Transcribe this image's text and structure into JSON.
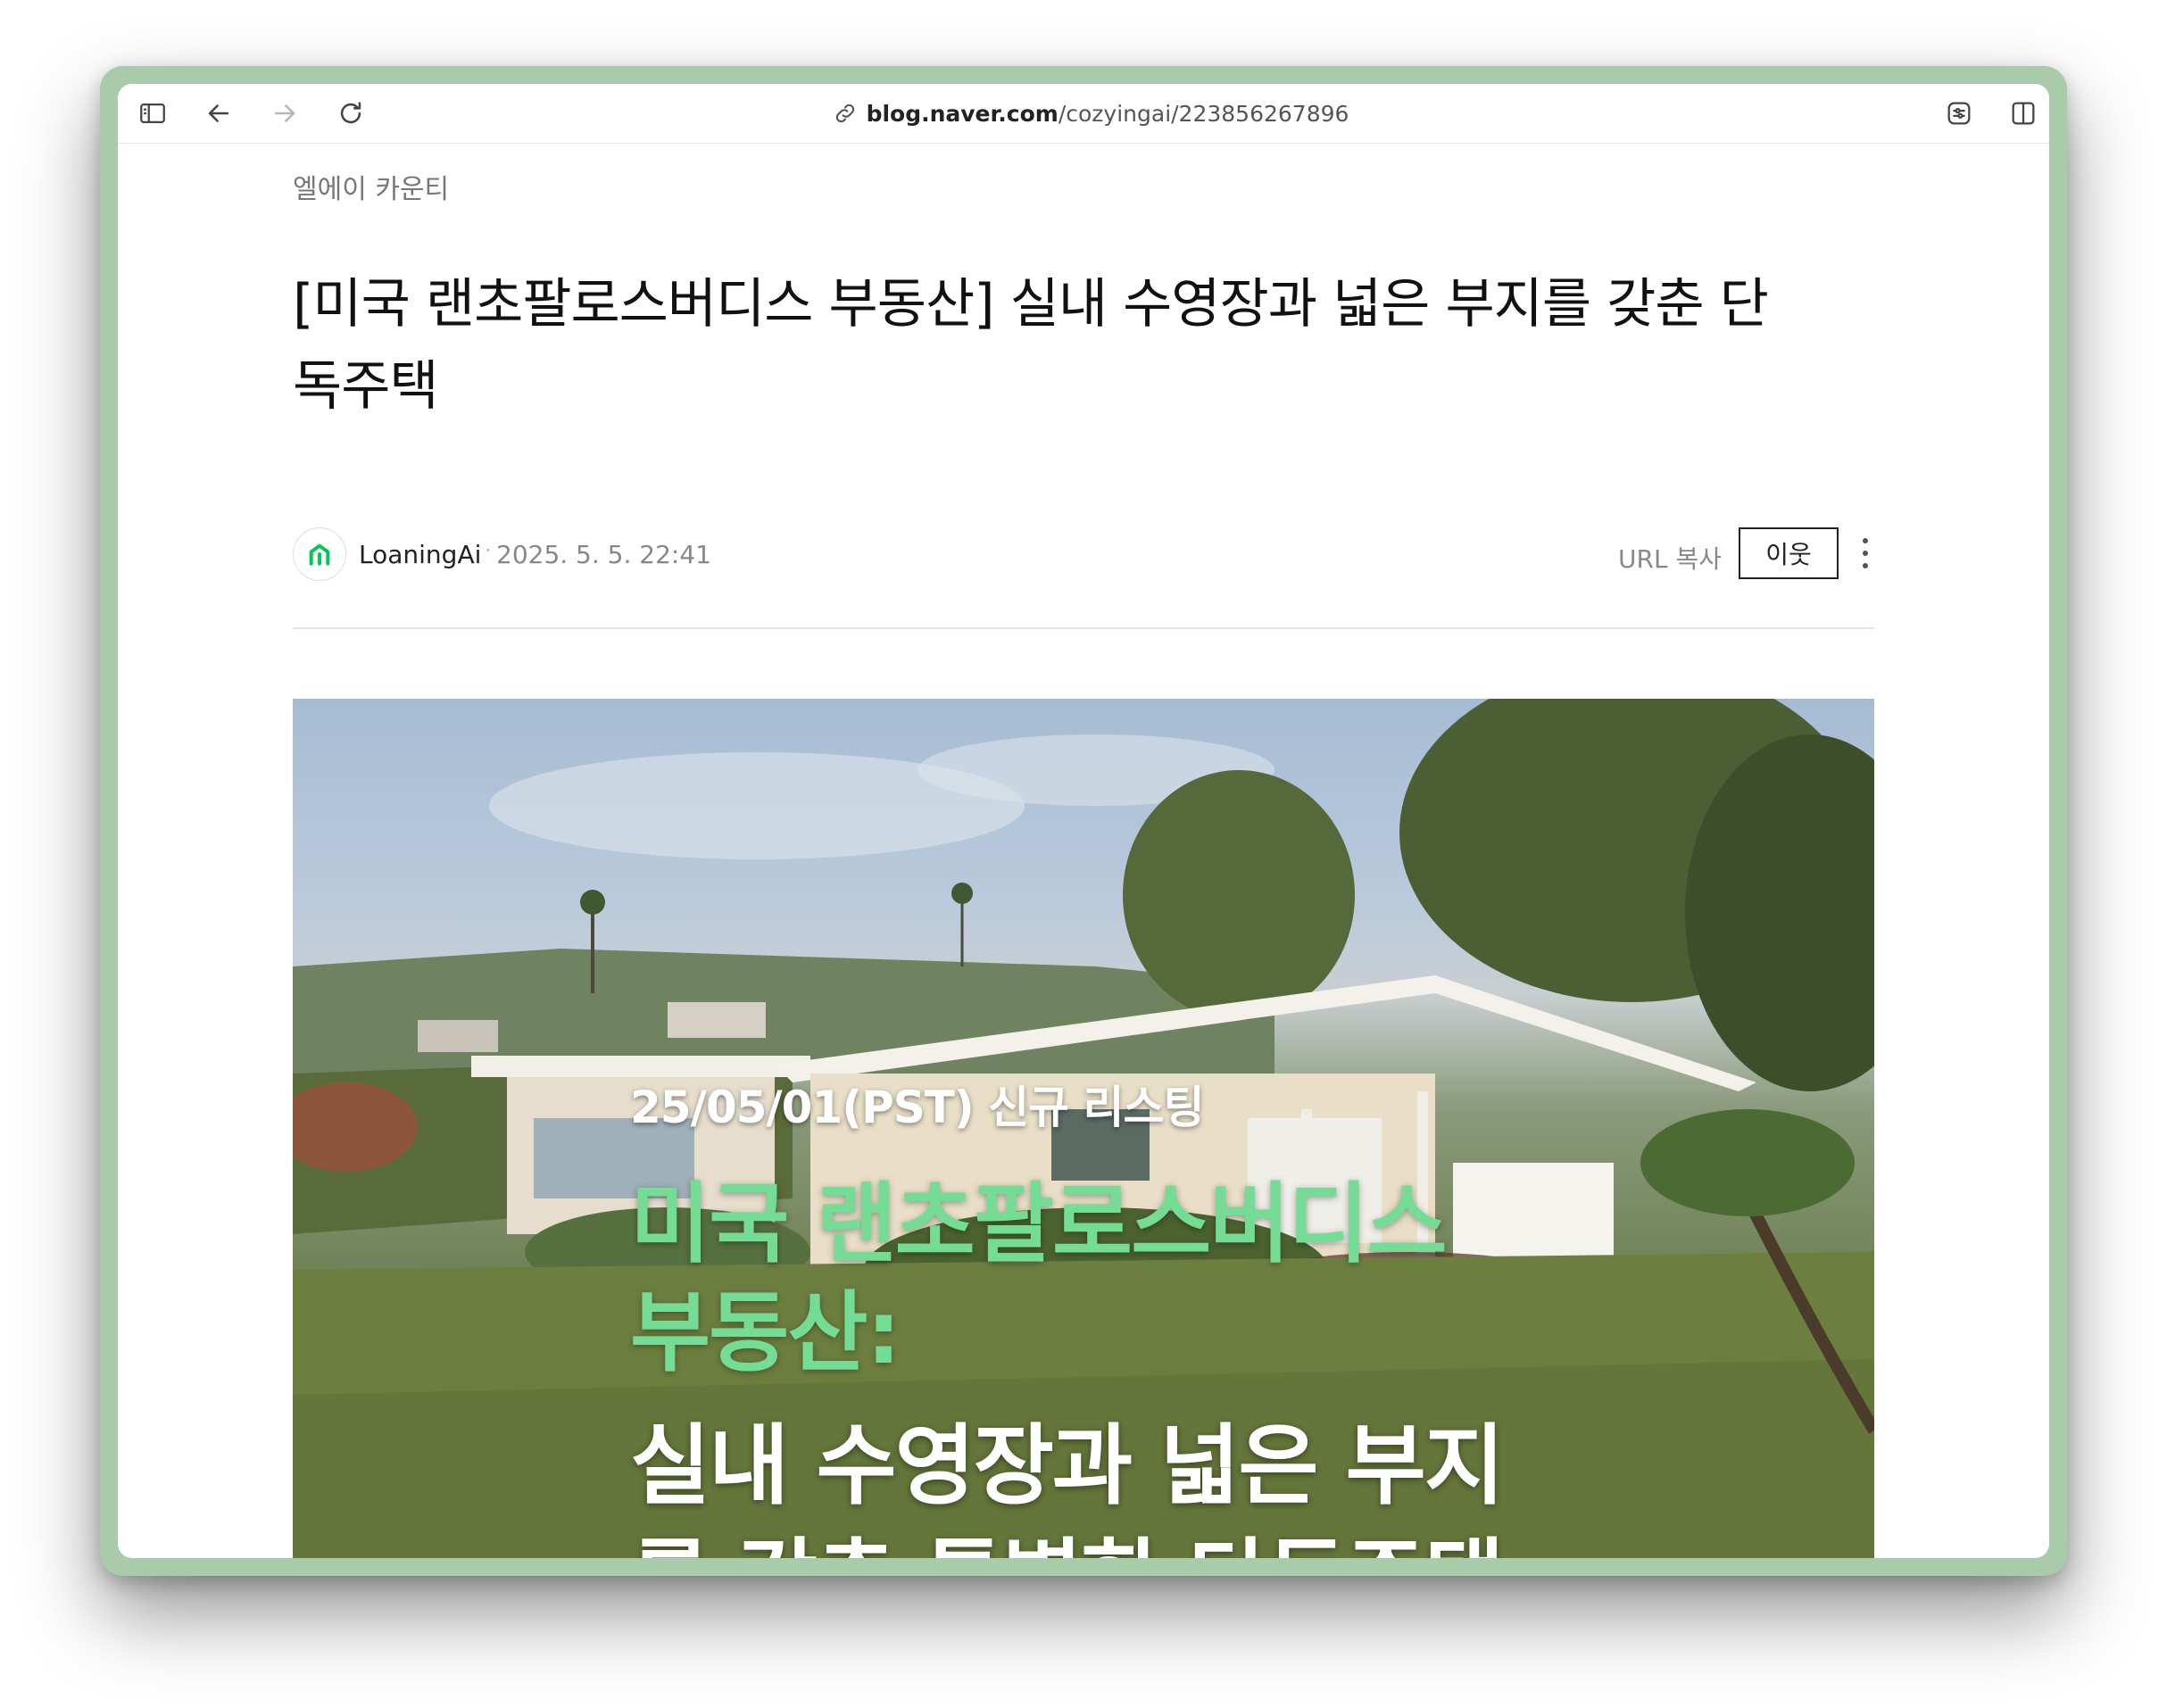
{
  "browser": {
    "address": {
      "host": "blog.naver.com",
      "path": "/cozyingai/223856267896"
    }
  },
  "post": {
    "category": "엘에이 카운티",
    "title_line1": "[미국 랜초팔로스버디스 부동산] 실내 수영장과 넓은 부지를 갖춘 단",
    "title_line2": "독주택",
    "author": "LoaningAi",
    "separator": "·",
    "date": "2025. 5. 5. 22:41",
    "url_copy": "URL 복사",
    "neighbor_button": "이웃"
  },
  "hero_image": {
    "listing_line": "25/05/01(PST) 신규 리스팅",
    "green_line1": "미국 랜초팔로스버디스",
    "green_line2": "부동산:",
    "white_line1": "실내 수영장과 넓은 부지",
    "white_line2": "를 갖춘 특별한 단독주택"
  },
  "colors": {
    "window_frame": "#a9cba9",
    "accent_green_text": "#74dc95",
    "naver_green": "#03c75a"
  },
  "icons": [
    "sidebar-icon",
    "back-arrow-icon",
    "forward-arrow-icon",
    "reload-icon",
    "link-icon",
    "page-settings-icon",
    "split-view-icon",
    "blog-logo-icon",
    "more-vertical-icon"
  ]
}
